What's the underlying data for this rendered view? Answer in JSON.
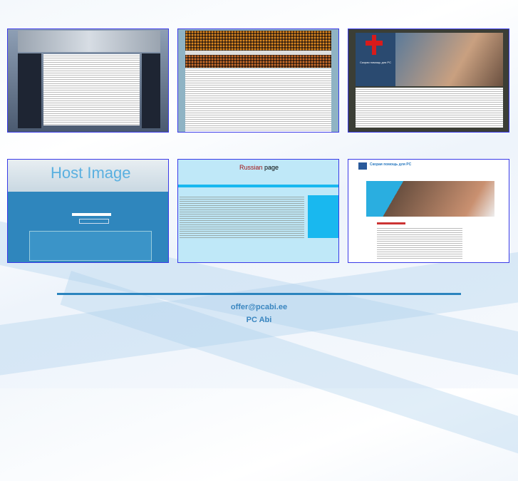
{
  "thumbnails": [
    {
      "label": "Website screenshot 1"
    },
    {
      "label": "Website screenshot 2"
    },
    {
      "label": "Website screenshot 3",
      "title": "Скорая помощь для PC"
    },
    {
      "label": "Website screenshot 4",
      "title": "Host Image"
    },
    {
      "label": "Website screenshot 5",
      "title_red": "Russian",
      "title_black": "page"
    },
    {
      "label": "Website screenshot 6",
      "title": "Скорая помощь для PC"
    }
  ],
  "footer": {
    "email": "offer@pcabi.ee",
    "company": "PC Abi"
  },
  "colors": {
    "accent": "#2b84be",
    "frame": "#3a3ae8"
  }
}
